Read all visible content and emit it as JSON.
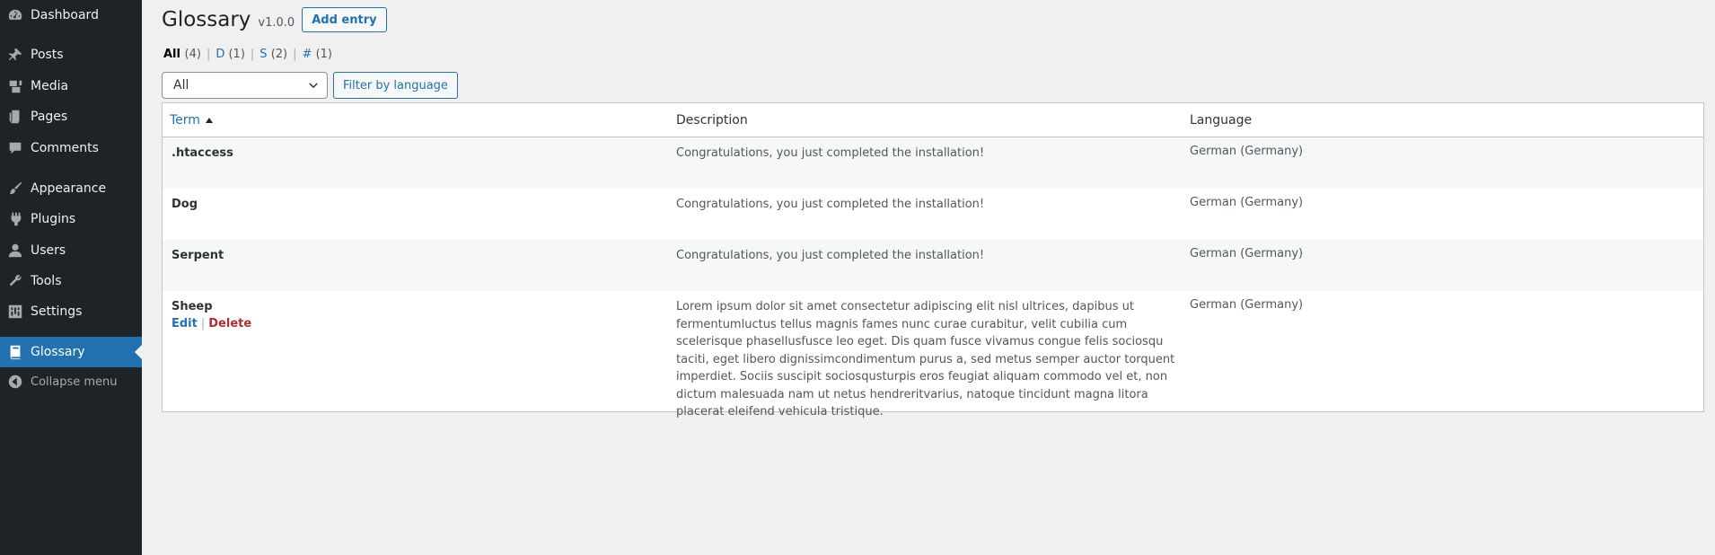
{
  "sidebar": {
    "items": [
      {
        "label": "Dashboard",
        "icon": "dashboard-icon"
      },
      {
        "label": "Posts",
        "icon": "pin-icon"
      },
      {
        "label": "Media",
        "icon": "media-icon"
      },
      {
        "label": "Pages",
        "icon": "pages-icon"
      },
      {
        "label": "Comments",
        "icon": "comment-icon"
      },
      {
        "label": "Appearance",
        "icon": "paintbrush-icon"
      },
      {
        "label": "Plugins",
        "icon": "plugin-icon"
      },
      {
        "label": "Users",
        "icon": "user-icon"
      },
      {
        "label": "Tools",
        "icon": "wrench-icon"
      },
      {
        "label": "Settings",
        "icon": "settings-icon"
      },
      {
        "label": "Glossary",
        "icon": "book-icon",
        "active": true
      }
    ],
    "collapse_label": "Collapse menu"
  },
  "header": {
    "title": "Glossary",
    "version": "v1.0.0",
    "add_entry_label": "Add entry"
  },
  "filters": {
    "links": [
      {
        "label": "All",
        "count": "(4)",
        "current": true
      },
      {
        "label": "D",
        "count": "(1)"
      },
      {
        "label": "S",
        "count": "(2)"
      },
      {
        "label": "#",
        "count": "(1)"
      }
    ],
    "language_select_value": "All",
    "filter_button_label": "Filter by language"
  },
  "table": {
    "columns": {
      "term": "Term",
      "description": "Description",
      "language": "Language"
    },
    "rows": [
      {
        "term": ".htaccess",
        "description": "Congratulations, you just completed the installation!",
        "language": "German (Germany)"
      },
      {
        "term": "Dog",
        "description": "Congratulations, you just completed the installation!",
        "language": "German (Germany)"
      },
      {
        "term": "Serpent",
        "description": "Congratulations, you just completed the installation!",
        "language": "German (Germany)"
      },
      {
        "term": "Sheep",
        "description": "Lorem ipsum dolor sit amet consectetur adipiscing elit nisl ultrices, dapibus ut fermentumluctus tellus magnis fames nunc curae curabitur, velit cubilia cum scelerisque phasellusfusce leo eget. Dis quam fusce vivamus congue felis sociosqu taciti, eget libero dignissimcondimentum purus a, sed metus semper auctor torquent imperdiet. Sociis suscipit sociosqusturpis eros feugiat aliquam commodo vel et, non dictum malesuada nam ut netus hendreritvarius, natoque tincidunt magna litora placerat eleifend vehicula tristique.",
        "language": "German (Germany)",
        "actions": {
          "edit": "Edit",
          "delete": "Delete"
        }
      }
    ]
  },
  "colors": {
    "sidebar_bg": "#1d2327",
    "accent": "#2271b1",
    "delete": "#b32d2e"
  }
}
